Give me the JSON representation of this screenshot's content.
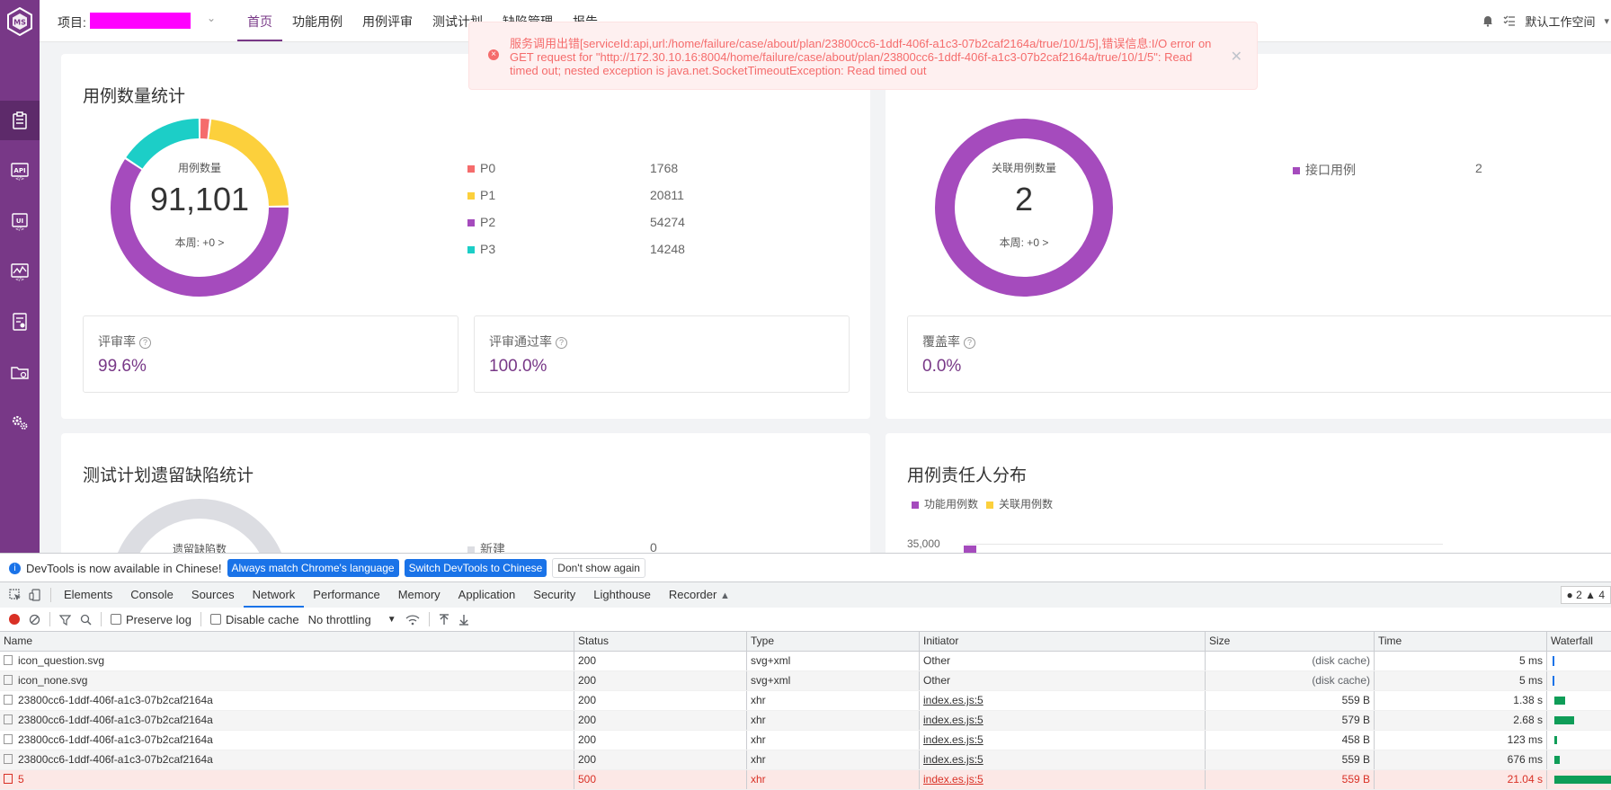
{
  "header": {
    "project_label": "项目:",
    "nav": [
      "首页",
      "功能用例",
      "用例评审",
      "测试计划",
      "缺陷管理",
      "报告"
    ],
    "workspace": "默认工作空间"
  },
  "toast": {
    "message": "服务调用出错[serviceId:api,url:/home/failure/case/about/plan/23800cc6-1ddf-406f-a1c3-07b2caf2164a/true/10/1/5],错误信息:I/O error on GET request for \"http://172.30.10.16:8004/home/failure/case/about/plan/23800cc6-1ddf-406f-a1c3-07b2caf2164a/true/10/1/5\": Read timed out; nested exception is java.net.SocketTimeoutException: Read timed out"
  },
  "case_stats": {
    "title": "用例数量统计",
    "center_label": "用例数量",
    "total": "91,101",
    "week": "本周: +0 >",
    "legend": [
      {
        "name": "P0",
        "value": "1768"
      },
      {
        "name": "P1",
        "value": "20811"
      },
      {
        "name": "P2",
        "value": "54274"
      },
      {
        "name": "P3",
        "value": "14248"
      }
    ],
    "review_rate_label": "评审率",
    "review_rate": "99.6%",
    "review_pass_label": "评审通过率",
    "review_pass": "100.0%"
  },
  "related_stats": {
    "center_label": "关联用例数量",
    "total": "2",
    "week": "本周: +0 >",
    "legend": [
      {
        "name": "接口用例",
        "value": "2"
      }
    ],
    "coverage_label": "覆盖率",
    "coverage": "0.0%"
  },
  "defect_stats": {
    "title": "测试计划遗留缺陷统计",
    "center_label": "遗留缺陷数",
    "legend": [
      {
        "name": "新建",
        "value": "0"
      }
    ]
  },
  "owner_dist": {
    "title": "用例责任人分布",
    "legend": [
      "功能用例数",
      "关联用例数"
    ],
    "tick": "35,000"
  },
  "chart_data": [
    {
      "type": "pie",
      "title": "用例数量统计",
      "categories": [
        "P0",
        "P1",
        "P2",
        "P3"
      ],
      "values": [
        1768,
        20811,
        54274,
        14248
      ]
    },
    {
      "type": "pie",
      "categories": [
        "接口用例"
      ],
      "values": [
        2
      ]
    }
  ],
  "colors": {
    "P0": "#f56c6c",
    "P1": "#fcd03c",
    "P2": "#a54bbd",
    "P3": "#1ccec7",
    "brand": "#783887"
  },
  "devtools": {
    "banner_text": "DevTools is now available in Chinese!",
    "btn_match": "Always match Chrome's language",
    "btn_switch": "Switch DevTools to Chinese",
    "btn_dont": "Don't show again",
    "tabs": [
      "Elements",
      "Console",
      "Sources",
      "Network",
      "Performance",
      "Memory",
      "Application",
      "Security",
      "Lighthouse",
      "Recorder"
    ],
    "issues": "● 2 ▲ 4",
    "preserve_log": "Preserve log",
    "disable_cache": "Disable cache",
    "throttling": "No throttling",
    "columns": [
      "Name",
      "Status",
      "Type",
      "Initiator",
      "Size",
      "Time",
      "Waterfall"
    ],
    "rows": [
      {
        "name": "icon_question.svg",
        "status": "200",
        "type": "svg+xml",
        "initiator": "Other",
        "size": "(disk cache)",
        "time": "5 ms"
      },
      {
        "name": "icon_none.svg",
        "status": "200",
        "type": "svg+xml",
        "initiator": "Other",
        "size": "(disk cache)",
        "time": "5 ms"
      },
      {
        "name": "23800cc6-1ddf-406f-a1c3-07b2caf2164a",
        "status": "200",
        "type": "xhr",
        "initiator": "index.es.js:5",
        "size": "559 B",
        "time": "1.38 s"
      },
      {
        "name": "23800cc6-1ddf-406f-a1c3-07b2caf2164a",
        "status": "200",
        "type": "xhr",
        "initiator": "index.es.js:5",
        "size": "579 B",
        "time": "2.68 s"
      },
      {
        "name": "23800cc6-1ddf-406f-a1c3-07b2caf2164a",
        "status": "200",
        "type": "xhr",
        "initiator": "index.es.js:5",
        "size": "458 B",
        "time": "123 ms"
      },
      {
        "name": "23800cc6-1ddf-406f-a1c3-07b2caf2164a",
        "status": "200",
        "type": "xhr",
        "initiator": "index.es.js:5",
        "size": "559 B",
        "time": "676 ms"
      },
      {
        "name": "5",
        "status": "500",
        "type": "xhr",
        "initiator": "index.es.js:5",
        "size": "559 B",
        "time": "21.04 s"
      }
    ]
  }
}
